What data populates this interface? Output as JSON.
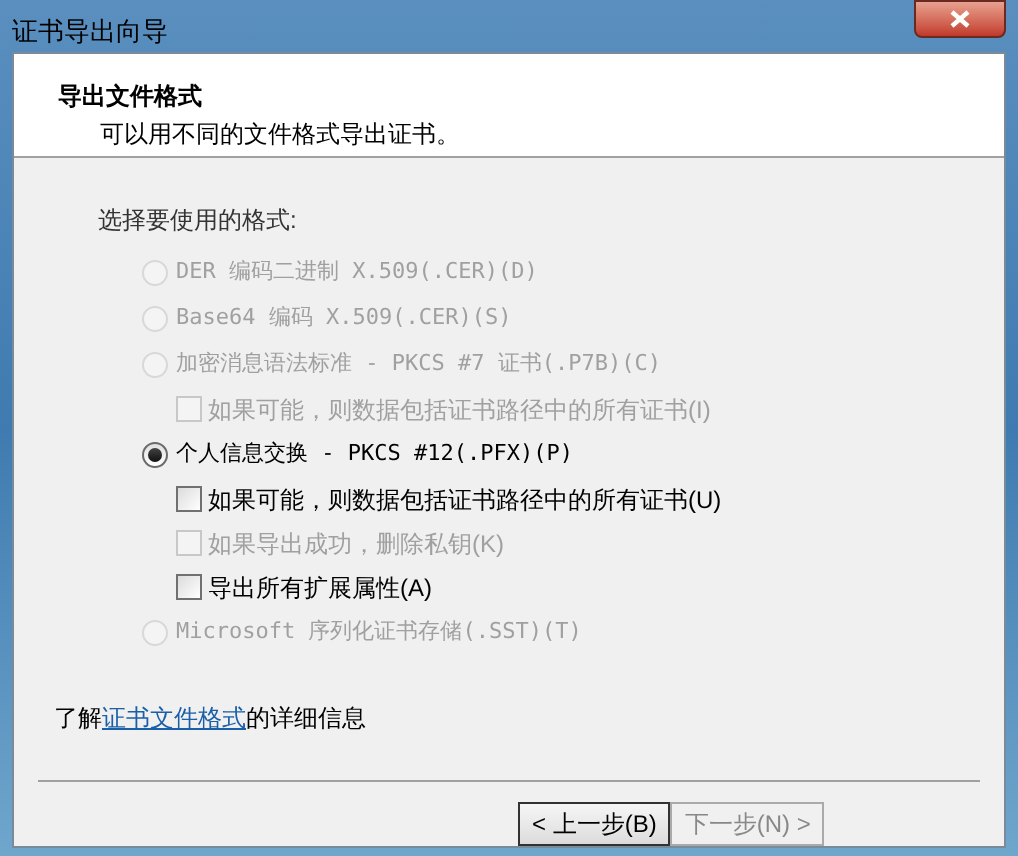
{
  "window": {
    "title": "证书导出向导"
  },
  "header": {
    "title": "导出文件格式",
    "subtitle": "可以用不同的文件格式导出证书。"
  },
  "prompt": "选择要使用的格式:",
  "formats": [
    {
      "label": "DER 编码二进制 X.509(.CER)(D)",
      "selected": false,
      "disabled": true
    },
    {
      "label": "Base64 编码 X.509(.CER)(S)",
      "selected": false,
      "disabled": true
    },
    {
      "label": "加密消息语法标准 - PKCS #7 证书(.P7B)(C)",
      "selected": false,
      "disabled": true,
      "options": [
        {
          "label": "如果可能，则数据包括证书路径中的所有证书(I)",
          "checked": false,
          "disabled": true
        }
      ]
    },
    {
      "label": "个人信息交换 - PKCS #12(.PFX)(P)",
      "selected": true,
      "disabled": false,
      "options": [
        {
          "label": "如果可能，则数据包括证书路径中的所有证书(U)",
          "checked": false,
          "disabled": false
        },
        {
          "label": "如果导出成功，删除私钥(K)",
          "checked": false,
          "disabled": true
        },
        {
          "label": "导出所有扩展属性(A)",
          "checked": false,
          "disabled": false
        }
      ]
    },
    {
      "label": "Microsoft 序列化证书存储(.SST)(T)",
      "selected": false,
      "disabled": true
    }
  ],
  "info": {
    "before": "了解",
    "link": "证书文件格式",
    "after": "的详细信息"
  },
  "buttons": [
    "< 上一步(B)",
    "下一步(N) >"
  ]
}
